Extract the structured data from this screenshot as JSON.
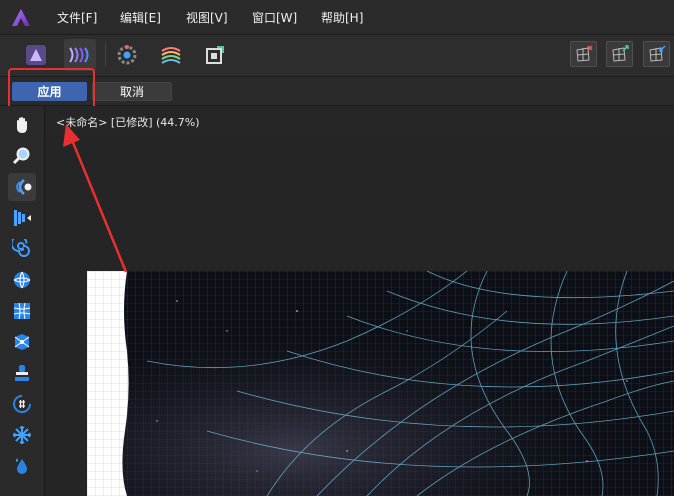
{
  "menubar": {
    "logo_icon": "affinity-photo-logo",
    "items": [
      "文件[F]",
      "编辑[E]",
      "视图[V]",
      "窗口[W]",
      "帮助[H]"
    ]
  },
  "toolbar": {
    "personas": [
      "photo-persona-icon",
      "liquify-persona-icon",
      "develop-persona-icon",
      "tone-mapping-persona-icon",
      "export-persona-icon"
    ],
    "active_persona": "liquify-persona-icon",
    "right_buttons": [
      "mesh-remove-icon",
      "mesh-add-icon",
      "mesh-reset-icon"
    ]
  },
  "context": {
    "apply_label": "应用",
    "cancel_label": "取消"
  },
  "tools": [
    "hand-tool-icon",
    "zoom-tool-icon",
    "push-forward-tool-icon",
    "push-left-tool-icon",
    "twirl-tool-icon",
    "pinch-tool-icon",
    "mesh-clone-tool-icon",
    "mesh-pin-tool-icon",
    "freeze-tool-icon",
    "thaw-tool-icon",
    "reconstruct-tool-icon",
    "turbulence-tool-icon"
  ],
  "active_tool": "push-forward-tool-icon",
  "document": {
    "title": "<未命名> [已修改] (44.7%)"
  },
  "colors": {
    "accent": "#3f64b0",
    "highlight": "#e83030",
    "mesh": "#6fb9d8"
  }
}
